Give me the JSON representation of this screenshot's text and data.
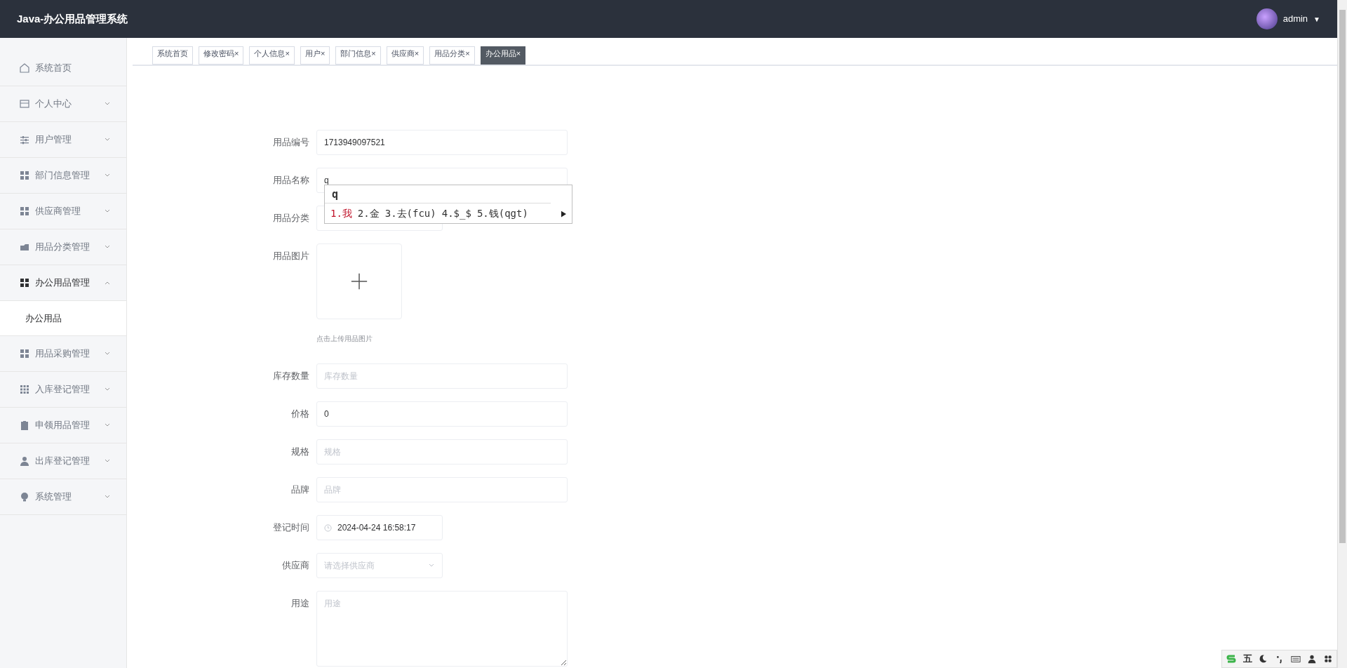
{
  "header": {
    "title": "Java-办公用品管理系统",
    "user": "admin",
    "caret": "▼"
  },
  "sidebar": {
    "items": [
      {
        "label": "系统首页"
      },
      {
        "label": "个人中心",
        "expanded": false
      },
      {
        "label": "用户管理",
        "expanded": false
      },
      {
        "label": "部门信息管理",
        "expanded": false
      },
      {
        "label": "供应商管理",
        "expanded": false
      },
      {
        "label": "用品分类管理",
        "expanded": false
      },
      {
        "label": "办公用品管理",
        "expanded": true,
        "children": [
          {
            "label": "办公用品",
            "selected": true
          }
        ]
      },
      {
        "label": "用品采购管理",
        "expanded": false
      },
      {
        "label": "入库登记管理",
        "expanded": false
      },
      {
        "label": "申领用品管理",
        "expanded": false
      },
      {
        "label": "出库登记管理",
        "expanded": false
      },
      {
        "label": "系统管理",
        "expanded": false
      }
    ]
  },
  "tabs": [
    {
      "label": "系统首页",
      "selected": false
    },
    {
      "label": "修改密码",
      "close": "×",
      "selected": false
    },
    {
      "label": "个人信息",
      "close": "×",
      "selected": false
    },
    {
      "label": "用户",
      "close": "×",
      "selected": false
    },
    {
      "label": "部门信息",
      "close": "×",
      "selected": false
    },
    {
      "label": "供应商",
      "close": "×",
      "selected": false
    },
    {
      "label": "用品分类",
      "close": "×",
      "selected": false
    },
    {
      "label": "办公用品",
      "close": "×",
      "selected": true
    }
  ],
  "form": {
    "fields": [
      {
        "kind": "input",
        "label": "用品编号",
        "value": "1713949097521"
      },
      {
        "kind": "input",
        "label": "用品名称",
        "value": "q"
      },
      {
        "kind": "select",
        "label": "用品分类"
      },
      {
        "kind": "upload",
        "label": "用品图片",
        "hint": "点击上传用品图片"
      },
      {
        "kind": "input",
        "label": "库存数量",
        "placeholder": "库存数量"
      },
      {
        "kind": "input",
        "label": "价格",
        "value": "0"
      },
      {
        "kind": "input",
        "label": "规格",
        "placeholder": "规格"
      },
      {
        "kind": "input",
        "label": "品牌",
        "placeholder": "品牌"
      },
      {
        "kind": "datetime",
        "label": "登记时间",
        "value": "2024-04-24 16:58:17"
      },
      {
        "kind": "select",
        "label": "供应商",
        "placeholder": "请选择供应商"
      },
      {
        "kind": "textarea",
        "label": "用途",
        "placeholder": "用途"
      }
    ]
  },
  "ime": {
    "composition": "q",
    "candidates": [
      {
        "label": "1.我",
        "selected": true
      },
      {
        "label": "2.金",
        "selected": false
      },
      {
        "label": "3.去(fcu)",
        "selected": false
      },
      {
        "label": "4.$_$",
        "selected": false
      },
      {
        "label": "5.钱(qgt)",
        "selected": false
      }
    ]
  },
  "ime_toolbar": {
    "mode": "五"
  }
}
